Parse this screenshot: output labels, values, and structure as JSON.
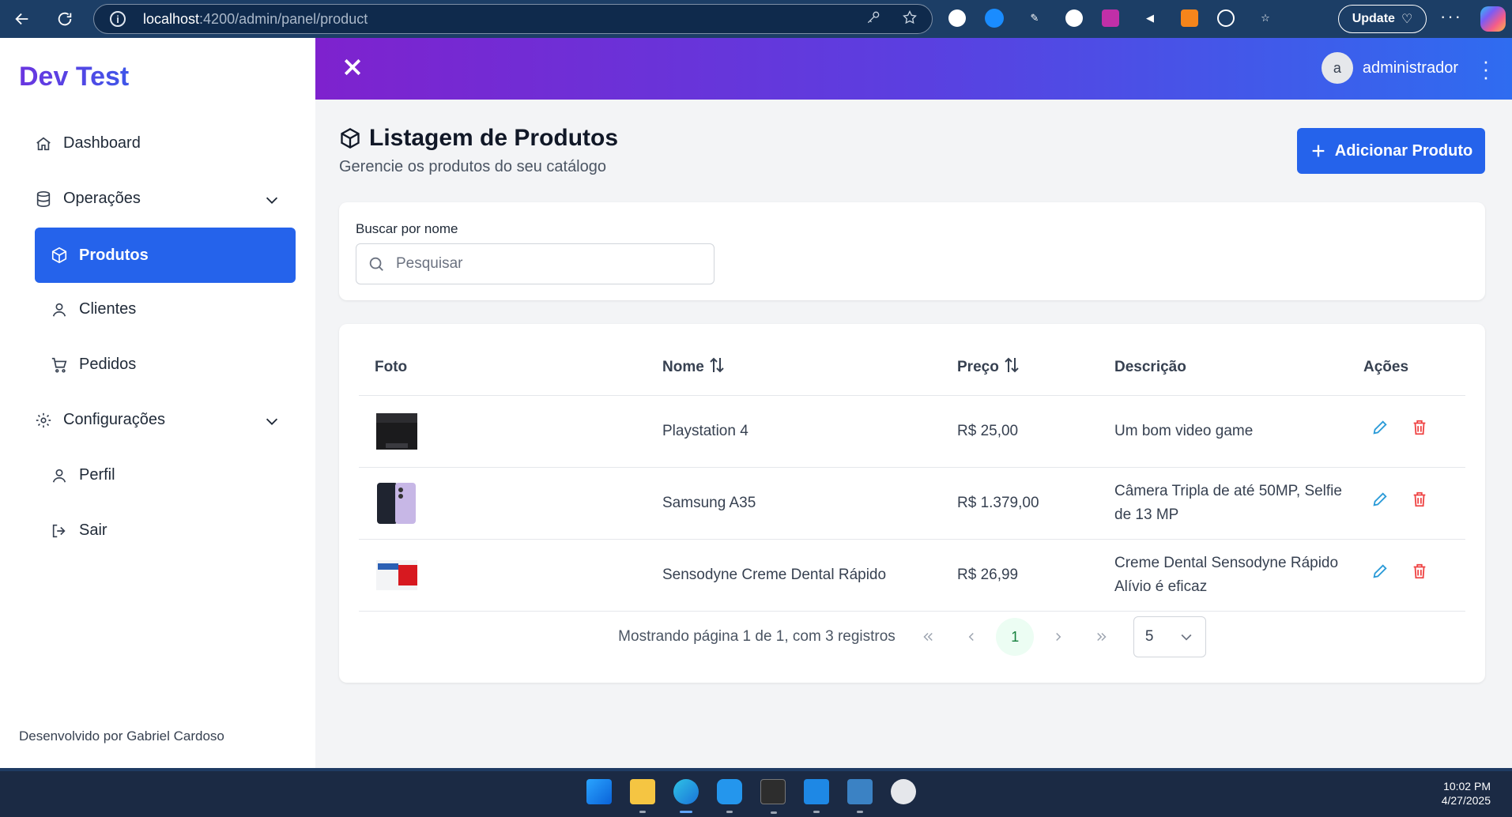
{
  "browser": {
    "url_host": "localhost",
    "url_path": ":4200/admin/panel/product",
    "update_label": "Update"
  },
  "sidebar": {
    "brand": "Dev Test",
    "items": [
      {
        "label": "Dashboard",
        "icon": "home-icon"
      },
      {
        "label": "Operações",
        "icon": "database-icon"
      },
      {
        "label": "Produtos",
        "icon": "box-icon",
        "active": true
      },
      {
        "label": "Clientes",
        "icon": "user-icon"
      },
      {
        "label": "Pedidos",
        "icon": "cart-icon"
      },
      {
        "label": "Configurações",
        "icon": "gear-icon"
      },
      {
        "label": "Perfil",
        "icon": "user-icon"
      },
      {
        "label": "Sair",
        "icon": "logout-icon"
      }
    ],
    "footer": "Desenvolvido por Gabriel Cardoso"
  },
  "topbar": {
    "avatar_letter": "a",
    "username": "administrador"
  },
  "page": {
    "title": "Listagem de Produtos",
    "subtitle": "Gerencie os produtos do seu catálogo",
    "add_button": "Adicionar Produto"
  },
  "search": {
    "label": "Buscar por nome",
    "placeholder": "Pesquisar",
    "value": ""
  },
  "table": {
    "headers": [
      "Foto",
      "Nome",
      "Preço",
      "Descrição",
      "Ações"
    ],
    "rows": [
      {
        "name": "Playstation 4",
        "price": "R$ 25,00",
        "description": "Um bom video game"
      },
      {
        "name": "Samsung A35",
        "price": "R$ 1.379,00",
        "description": "Câmera Tripla de até 50MP, Selfie de 13 MP"
      },
      {
        "name": "Sensodyne Creme Dental Rápido",
        "price": "R$ 26,99",
        "description": "Creme Dental Sensodyne Rápido Alívio é eficaz"
      }
    ]
  },
  "pager": {
    "info": "Mostrando página 1 de 1, com 3 registros",
    "current_page": "1",
    "rows_per_page": "5"
  },
  "taskbar": {
    "time": "10:02 PM",
    "date": "4/27/2025"
  },
  "colors": {
    "primary": "#2563eb",
    "topbar_start": "#7e22ce",
    "topbar_end": "#2f6cf0",
    "delete": "#ef4444",
    "edit": "#2b9bd8"
  }
}
